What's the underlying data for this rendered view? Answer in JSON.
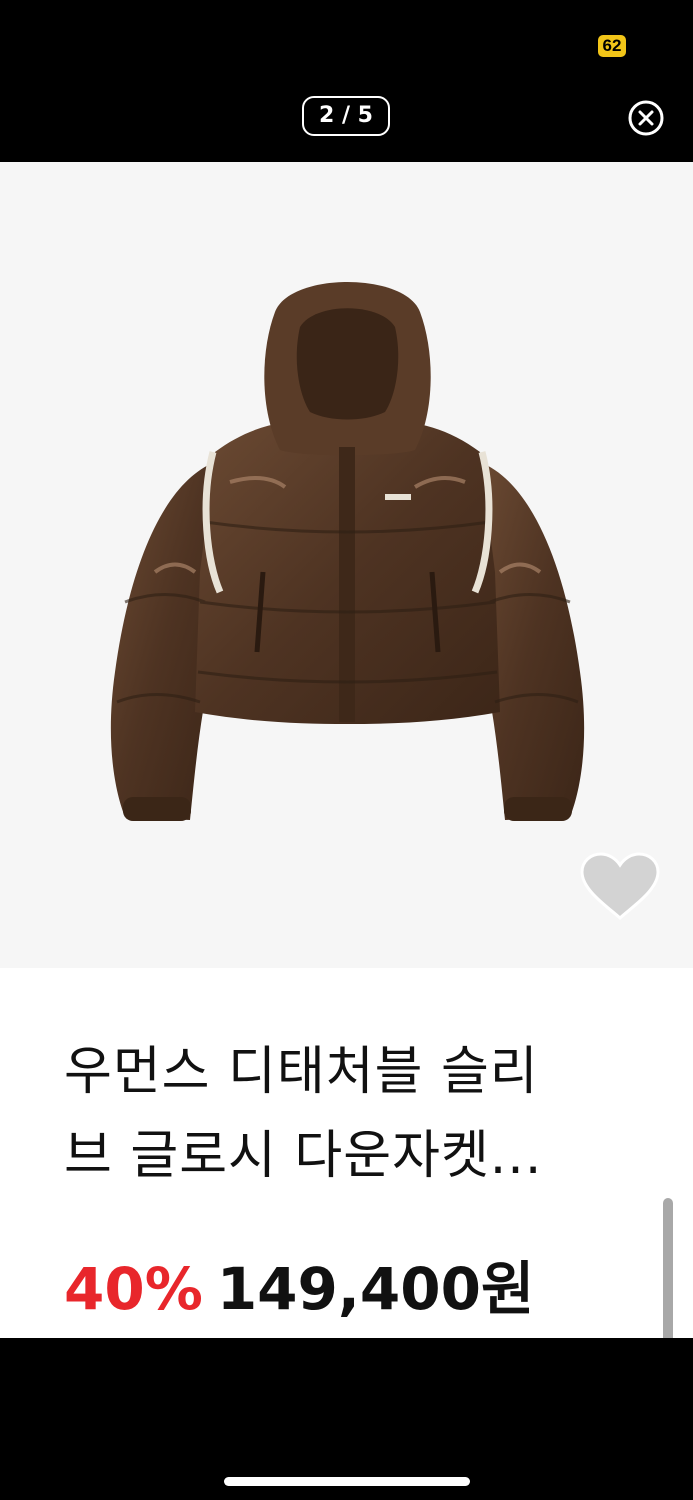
{
  "status_bar": {
    "battery_level": "62",
    "battery_color": "#f2c518"
  },
  "viewer": {
    "page_counter": "2 / 5",
    "close_icon": "close-circle-icon"
  },
  "product": {
    "title_line_1": "우먼스 디태처블 슬리",
    "title_line_2": "브 글로시 다운자켓...",
    "discount": "40%",
    "price": "149,400원",
    "wishlist_icon": "heart-icon",
    "image_subject": "brown-glossy-puffer-jacket"
  },
  "colors": {
    "discount": "#e8262b",
    "jacket": "#5a3c28",
    "background": "#f6f6f6"
  }
}
